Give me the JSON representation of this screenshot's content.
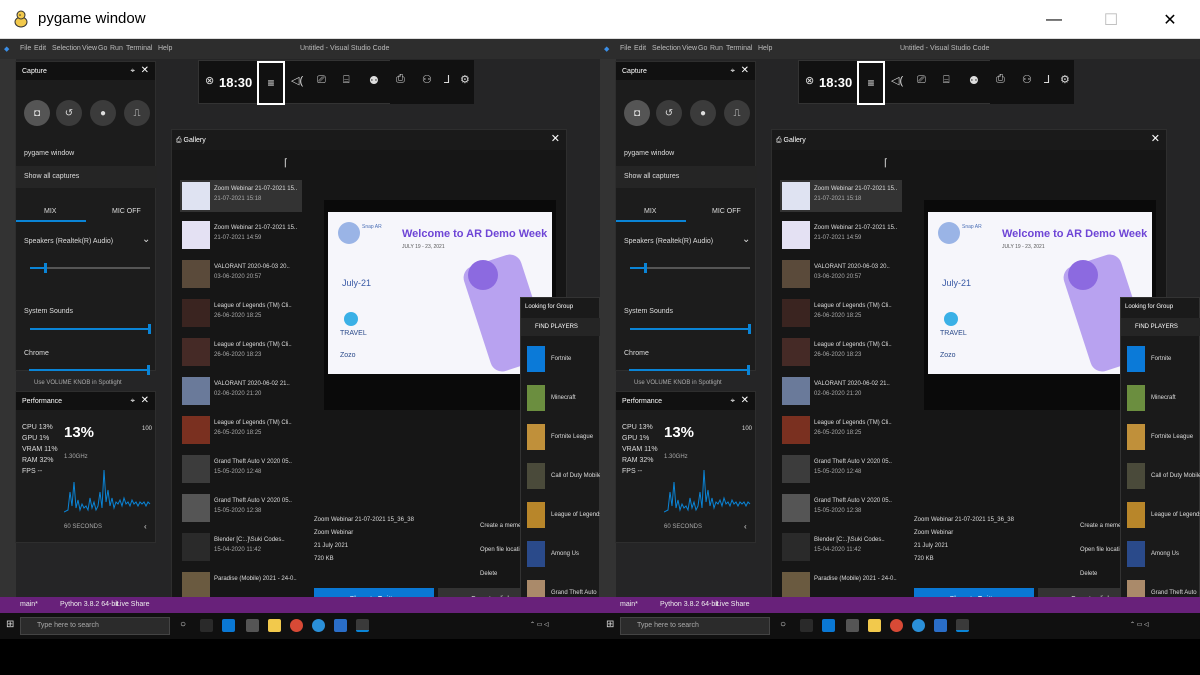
{
  "window": {
    "title": "pygame window",
    "min": "—",
    "max": "☐",
    "close": "✕"
  },
  "vs": {
    "menu": [
      "File",
      "Edit",
      "Selection",
      "View",
      "Go",
      "Run",
      "Terminal",
      "Help"
    ],
    "title": "Untitled - Visual Studio Code",
    "status": {
      "branch": "main*",
      "python": "Python 3.8.2 64-bit",
      "live": "Live Share"
    },
    "search": "Type here to search"
  },
  "gamebar": {
    "time": "18:30"
  },
  "capture": {
    "title": "Capture",
    "target": "pygame window",
    "show_all": "Show all captures",
    "tab_on": "MIX",
    "tab_off": "MIC OFF",
    "device": "Speakers (Realtek(R) Audio)",
    "apps": [
      "System Sounds",
      "Chrome"
    ],
    "bottom": "Use VOLUME KNOB in Spotlight"
  },
  "performance": {
    "title": "Performance",
    "cpu": "CPU 13%",
    "gpu": "GPU 1%",
    "vram": "VRAM 11%",
    "ram": "RAM 32%",
    "fps": "FPS --",
    "big": "13%",
    "freq": "1.30GHz",
    "max": "100",
    "window": "60 SECONDS"
  },
  "gallery": {
    "title": "Gallery",
    "thumbs": [
      {
        "t1": "Zoom Webinar 21-07-2021 15..",
        "t2": "21-07-2021 15:18",
        "color": "#dfe3f2"
      },
      {
        "t1": "Zoom Webinar 21-07-2021 15..",
        "t2": "21-07-2021 14:59",
        "color": "#e4e1f3"
      },
      {
        "t1": "VALORANT 2020-06-03 20..",
        "t2": "03-06-2020 20:57",
        "color": "#5a4a3a"
      },
      {
        "t1": "League of Legends (TM) Cli..",
        "t2": "26-06-2020 18:25",
        "color": "#3a2420"
      },
      {
        "t1": "League of Legends (TM) Cli..",
        "t2": "26-06-2020 18:23",
        "color": "#452a26"
      },
      {
        "t1": "VALORANT 2020-06-02 21..",
        "t2": "02-06-2020 21:20",
        "color": "#6a7a9a"
      },
      {
        "t1": "League of Legends (TM) Cli..",
        "t2": "26-05-2020 18:25",
        "color": "#7a3020"
      },
      {
        "t1": "Grand Theft Auto V 2020 05..",
        "t2": "15-05-2020 12:48",
        "color": "#3c3c3c"
      },
      {
        "t1": "Grand Theft Auto V 2020 05..",
        "t2": "15-05-2020 12:38",
        "color": "#555"
      },
      {
        "t1": "Blender [C:..]\\Suki Codes..",
        "t2": "15-04-2020 11:42",
        "color": "#2a2a2a"
      },
      {
        "t1": "Paradise (Mobile) 2021 - 24-0..",
        "t2": "",
        "color": "#6a5a40"
      }
    ],
    "slide": {
      "heading": "Welcome to AR Demo Week",
      "sub": "JULY 19 - 23, 2021",
      "date": "July-21",
      "travel": "TRAVEL",
      "zozo": "Zozo"
    },
    "meta": {
      "name": "Zoom Webinar 21-07-2021 15_36_38",
      "app": "Zoom Webinar",
      "date": "21 July 2021",
      "size": "720 KB"
    },
    "actions": [
      "Create a meme",
      "Open file location",
      "Delete"
    ],
    "share": "Share to Twitter",
    "copy": "Copy to clipboard"
  },
  "lfg": {
    "title": "Looking for Group",
    "find": "FIND PLAYERS",
    "games": [
      {
        "name": "Fortnite",
        "color": "#0b7ad8"
      },
      {
        "name": "Minecraft",
        "color": "#6b8e3f"
      },
      {
        "name": "Fortnite League",
        "color": "#c0903a"
      },
      {
        "name": "Call of Duty Mobile",
        "color": "#4a4a3a"
      },
      {
        "name": "League of Legends",
        "color": "#b8862a"
      },
      {
        "name": "Among Us",
        "color": "#2a4a8a"
      },
      {
        "name": "Grand Theft Auto",
        "color": "#aa8a6a"
      }
    ]
  },
  "colors": {
    "accent": "#0a78d4",
    "status_bar": "#68217a"
  }
}
